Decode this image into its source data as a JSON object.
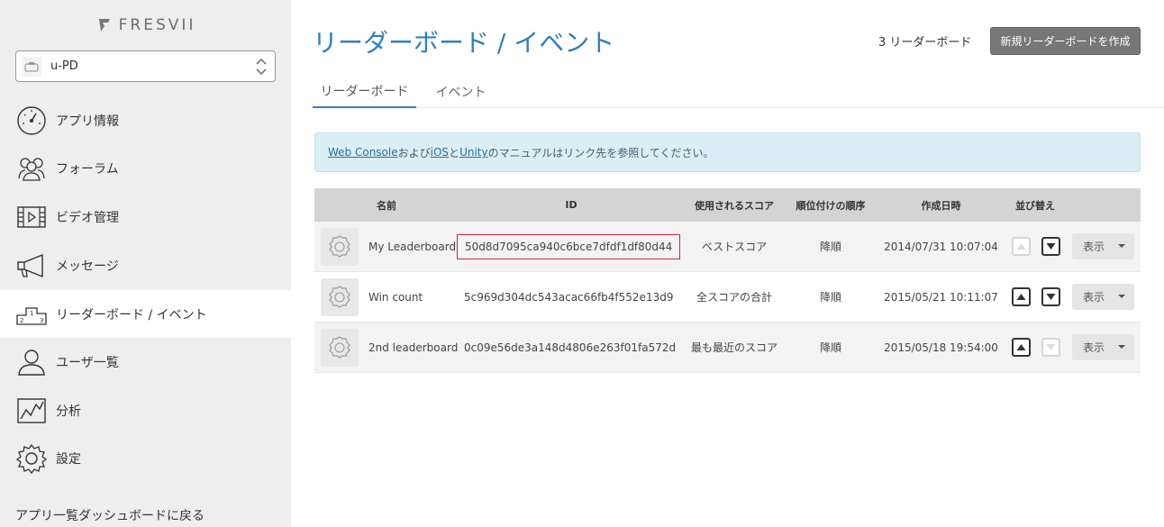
{
  "brand": {
    "name": "FRESVII"
  },
  "app_selector": {
    "value": "u-PD"
  },
  "sidebar": {
    "items": [
      {
        "label": "アプリ情報",
        "icon": "dashboard-gauge-icon"
      },
      {
        "label": "フォーラム",
        "icon": "users-group-icon"
      },
      {
        "label": "ビデオ管理",
        "icon": "video-film-icon"
      },
      {
        "label": "メッセージ",
        "icon": "megaphone-icon"
      },
      {
        "label": "リーダーボード / イベント",
        "icon": "podium-icon",
        "active": true
      },
      {
        "label": "ユーザ一覧",
        "icon": "user-icon"
      },
      {
        "label": "分析",
        "icon": "analytics-chart-icon"
      },
      {
        "label": "設定",
        "icon": "gear-icon"
      }
    ],
    "back_link": "アプリ一覧ダッシュボードに戻る"
  },
  "header": {
    "title": "リーダーボード / イベント",
    "count_text": "3 リーダーボード",
    "new_button": "新規リーダーボードを作成"
  },
  "tabs": [
    {
      "label": "リーダーボード",
      "active": true
    },
    {
      "label": "イベント",
      "active": false
    }
  ],
  "info": {
    "link_web_console": "Web Console",
    "text_and1": " および ",
    "link_ios": "iOS",
    "text_and2": " と ",
    "link_unity": "Unity",
    "text_rest": " のマニュアルはリンク先を参照してください。"
  },
  "table": {
    "headers": {
      "name": "名前",
      "id": "ID",
      "score": "使用されるスコア",
      "order": "順位付けの順序",
      "created": "作成日時",
      "sort": "並び替え"
    },
    "rows": [
      {
        "name": "My Leaderboard",
        "id": "50d8d7095ca940c6bce7dfdf1df80d44",
        "score": "ベストスコア",
        "order": "降順",
        "created": "2014/07/31 10:07:04",
        "action": "表示"
      },
      {
        "name": "Win count",
        "id": "5c969d304dc543acac66fb4f552e13d9",
        "score": "全スコアの合計",
        "order": "降順",
        "created": "2015/05/21 10:11:07",
        "action": "表示"
      },
      {
        "name": "2nd leaderboard",
        "id": "0c09e56de3a148d4806e263f01fa572d",
        "score": "最も最近のスコア",
        "order": "降順",
        "created": "2015/05/18 19:54:00",
        "action": "表示"
      }
    ]
  }
}
